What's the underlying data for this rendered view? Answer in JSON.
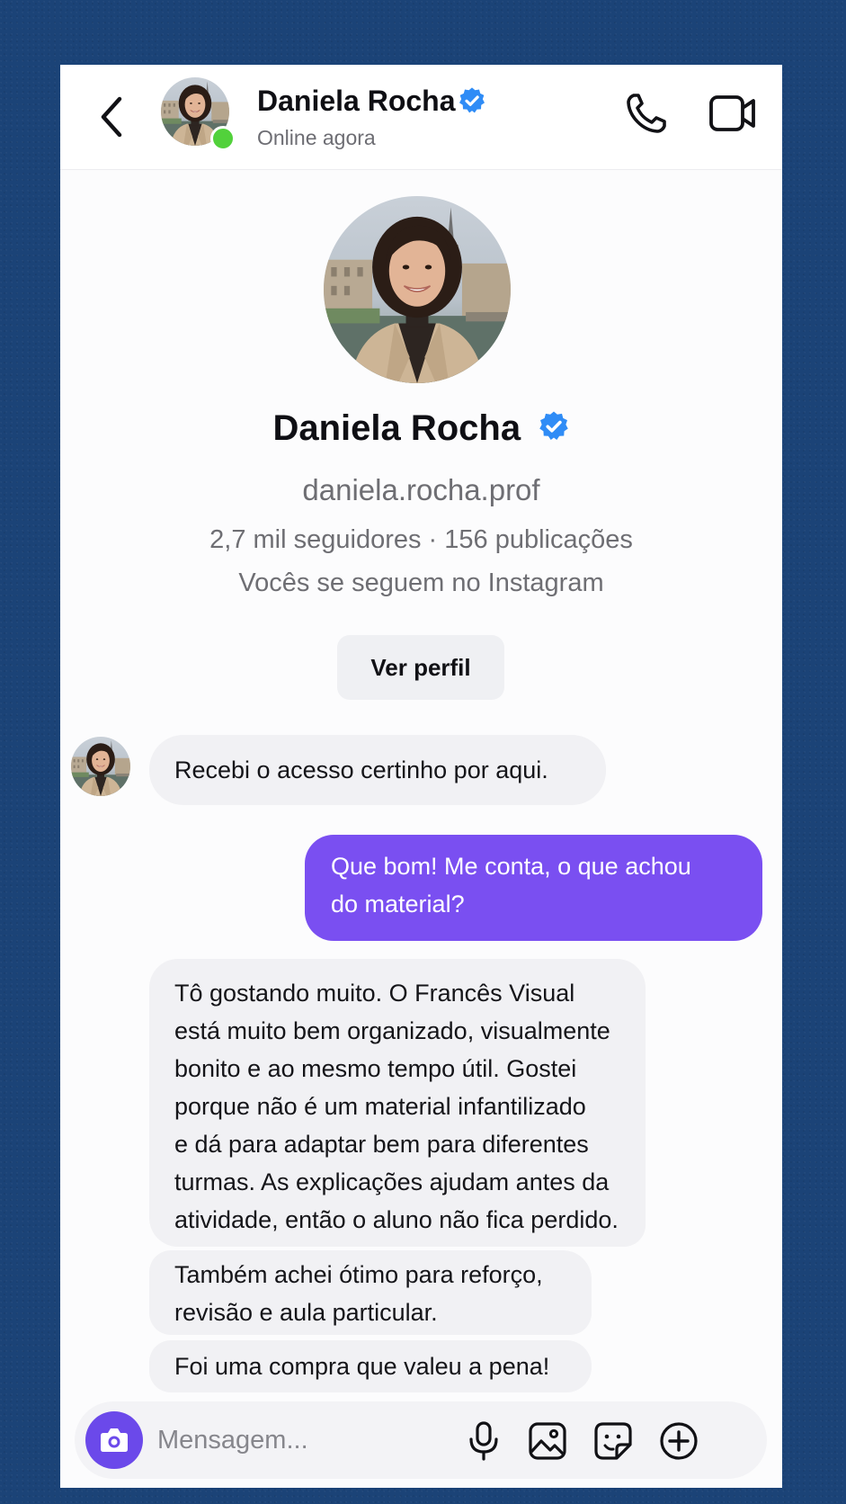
{
  "header": {
    "name": "Daniela Rocha",
    "status": "Online agora"
  },
  "profile": {
    "name": "Daniela Rocha",
    "handle": "daniela.rocha.prof",
    "stats": "2,7 mil seguidores · 156 publicações",
    "mutual": "Vocês se seguem no Instagram",
    "view_profile_label": "Ver perfil"
  },
  "messages": [
    {
      "direction": "incoming",
      "lines": [
        "Recebi o acesso certinho por aqui."
      ]
    },
    {
      "direction": "outgoing",
      "lines": [
        "Que bom! Me conta, o que achou",
        "do material?"
      ]
    },
    {
      "direction": "incoming",
      "lines": [
        "Tô gostando muito. O Francês Visual",
        "está muito bem organizado, visualmente",
        "bonito e ao mesmo tempo útil. Gostei",
        "porque não é um material infantilizado",
        "e dá para adaptar bem para diferentes",
        "turmas. As explicações ajudam antes da",
        "atividade, então o aluno não fica perdido."
      ]
    },
    {
      "direction": "incoming",
      "lines": [
        "Também achei ótimo para reforço,",
        "revisão e aula particular."
      ]
    },
    {
      "direction": "incoming",
      "lines": [
        "Foi uma compra que valeu a pena!"
      ]
    }
  ],
  "composer": {
    "placeholder": "Mensagem..."
  },
  "icons": {
    "back": "chevron-left-icon",
    "verified": "verified-badge-icon",
    "call": "phone-icon",
    "video": "video-camera-icon",
    "camera": "camera-icon",
    "mic": "microphone-icon",
    "gallery": "image-icon",
    "sticker": "sticker-icon",
    "plus": "plus-circle-icon"
  },
  "colors": {
    "background": "#1b4377",
    "outgoing_bubble": "#7a4ff1",
    "incoming_bubble": "#f1f1f4",
    "verified": "#2f8cf6",
    "online": "#52d13b",
    "camera_button": "#6b49ea"
  }
}
